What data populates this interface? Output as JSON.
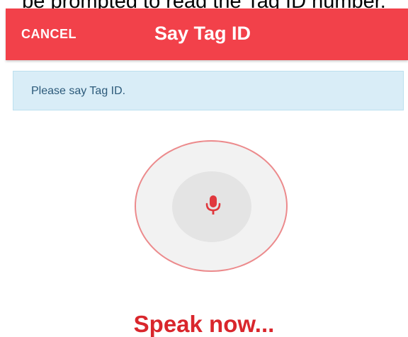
{
  "caption": "be prompted to read the Tag ID number.",
  "header": {
    "cancel_label": "CANCEL",
    "title": "Say Tag ID"
  },
  "prompt": {
    "text": "Please say Tag ID."
  },
  "microphone": {
    "icon": "microphone-icon"
  },
  "status": {
    "text": "Speak now..."
  },
  "colors": {
    "app_bar": "#f2414a",
    "prompt_background": "#d9edf7",
    "prompt_text": "#2c5a7a",
    "mic_ring": "#ec8a8c",
    "mic_icon": "#e0383d",
    "status_text": "#d9262c"
  }
}
